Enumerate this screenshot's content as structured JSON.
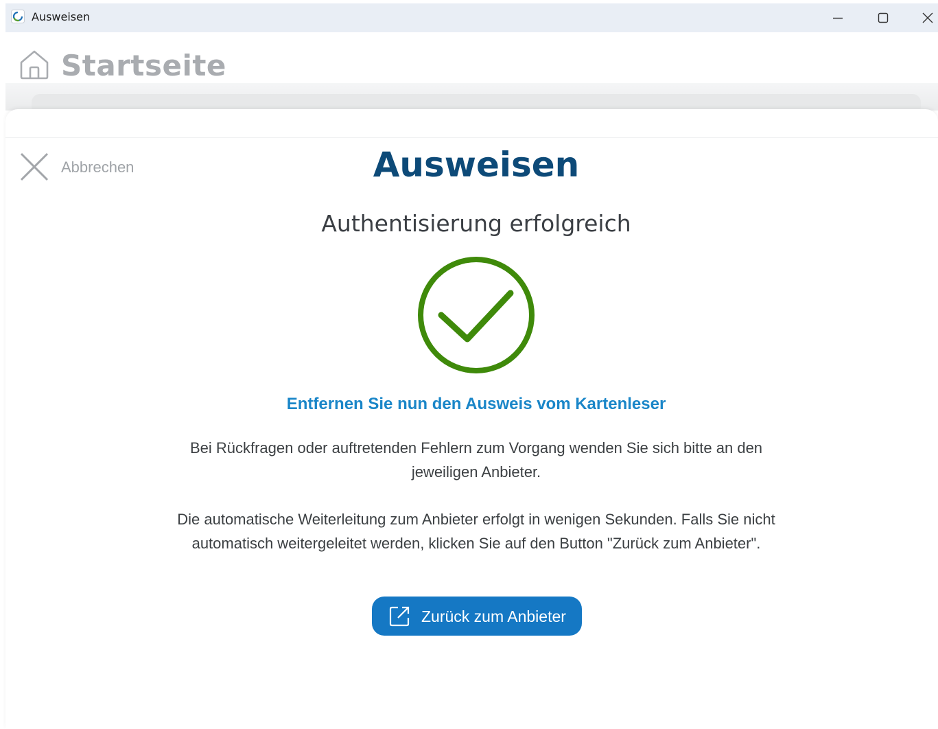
{
  "titlebar": {
    "title": "Ausweisen",
    "app_icon": "ausweisapp-ring-icon",
    "buttons": [
      "minimize-icon",
      "maximize-icon",
      "close-icon"
    ]
  },
  "header": {
    "title": "Startseite",
    "icon": "home-icon"
  },
  "dialog": {
    "cancel_label": "Abbrechen",
    "title": "Ausweisen",
    "subtitle": "Authentisierung erfolgreich",
    "status_icon": "checkmark-circle-icon",
    "instruction": "Entfernen Sie nun den Ausweis vom Kartenleser",
    "info_1": "Bei Rückfragen oder auftretenden Fehlern zum Vorgang wenden Sie sich bitte an den jeweiligen Anbieter.",
    "info_2": "Die automatische Weiterleitung zum Anbieter erfolgt in wenigen Sekunden. Falls Sie nicht automatisch weitergeleitet werden, klicken Sie auf den Button \"Zurück zum Anbieter\".",
    "back_button_label": "Zurück zum Anbieter",
    "back_button_icon": "external-link-icon"
  },
  "colors": {
    "title_blue": "#0d4a78",
    "link_blue": "#1a86c8",
    "button_blue": "#1578c4",
    "success_green": "#3f8a0a",
    "muted_gray": "#a9acb0"
  }
}
